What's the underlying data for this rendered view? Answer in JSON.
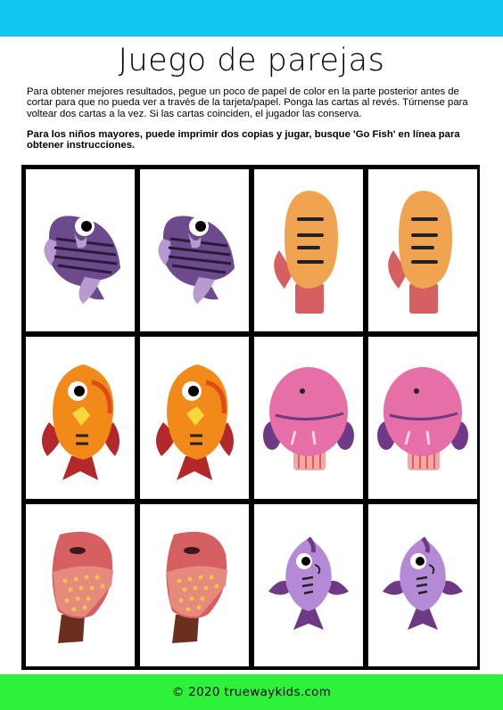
{
  "colors": {
    "top_bar": "#12c7ef",
    "footer_bar": "#2ef13a",
    "grid_border": "#000000"
  },
  "title": "Juego de parejas",
  "instructions": "Para obtener mejores resultados, pegue un poco de papel de color en la parte posterior antes de cortar para que no pueda ver a través de la tarjeta/papel. Ponga las cartas al revés. Túrnense para voltear dos cartas a la vez. Si las cartas coinciden, el jugador las conserva.",
  "note": "Para los niños mayores, puede imprimir dos copias y jugar, busque 'Go Fish' en línea para obtener instrucciones.",
  "cards": [
    {
      "fish": "purple-striped-fish-icon"
    },
    {
      "fish": "purple-striped-fish-icon"
    },
    {
      "fish": "orange-tall-fish-icon"
    },
    {
      "fish": "orange-tall-fish-icon"
    },
    {
      "fish": "orange-red-fin-fish-icon"
    },
    {
      "fish": "orange-red-fin-fish-icon"
    },
    {
      "fish": "pink-round-fish-icon"
    },
    {
      "fish": "pink-round-fish-icon"
    },
    {
      "fish": "red-spotted-fish-icon"
    },
    {
      "fish": "red-spotted-fish-icon"
    },
    {
      "fish": "lilac-fish-icon"
    },
    {
      "fish": "lilac-fish-icon"
    }
  ],
  "footer": "© 2020 truewaykids.com"
}
